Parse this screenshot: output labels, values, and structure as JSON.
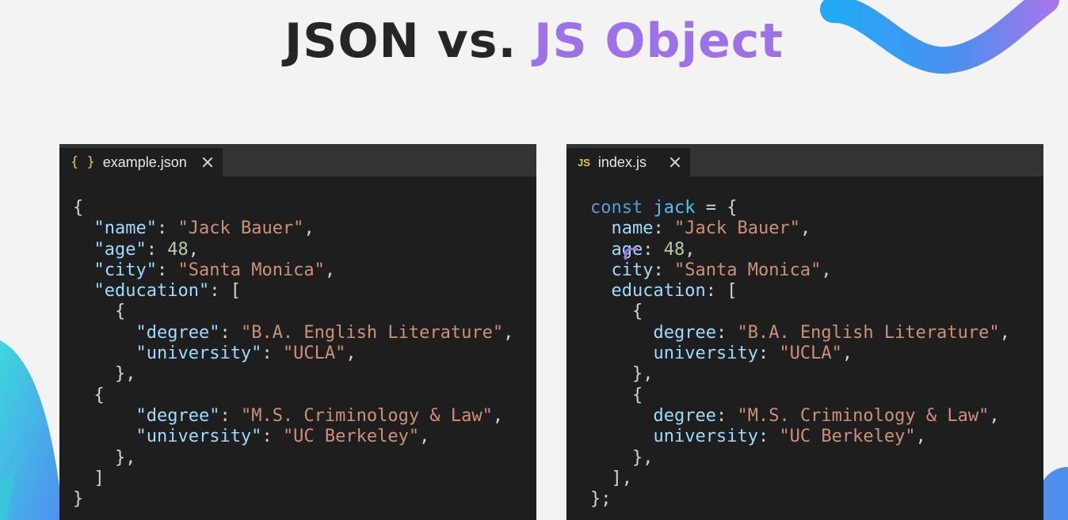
{
  "title": {
    "part1": "JSON vs.",
    "part2": "JS Object"
  },
  "colors": {
    "accent": "#9d71e8",
    "background": "#f3f3f3",
    "editor_bg": "#1e1e1e"
  },
  "editors": [
    {
      "tab_icon": "{ }",
      "tab_icon_name": "json-braces-icon",
      "tab_label": "example.json",
      "lines": [
        [
          {
            "t": "{",
            "c": "p"
          }
        ],
        [
          {
            "t": "  "
          },
          {
            "t": "\"name\"",
            "c": "key"
          },
          {
            "t": ": "
          },
          {
            "t": "\"Jack Bauer\"",
            "c": "str"
          },
          {
            "t": ","
          }
        ],
        [
          {
            "t": "  "
          },
          {
            "t": "\"age\"",
            "c": "key"
          },
          {
            "t": ": "
          },
          {
            "t": "48",
            "c": "num"
          },
          {
            "t": ","
          }
        ],
        [
          {
            "t": "  "
          },
          {
            "t": "\"city\"",
            "c": "key"
          },
          {
            "t": ": "
          },
          {
            "t": "\"Santa Monica\"",
            "c": "str"
          },
          {
            "t": ","
          }
        ],
        [
          {
            "t": "  "
          },
          {
            "t": "\"education\"",
            "c": "key"
          },
          {
            "t": ": ["
          }
        ],
        [
          {
            "t": "    {"
          }
        ],
        [
          {
            "t": "      "
          },
          {
            "t": "\"degree\"",
            "c": "key"
          },
          {
            "t": ": "
          },
          {
            "t": "\"B.A. English Literature\"",
            "c": "str"
          },
          {
            "t": ","
          }
        ],
        [
          {
            "t": "      "
          },
          {
            "t": "\"university\"",
            "c": "key"
          },
          {
            "t": ": "
          },
          {
            "t": "\"UCLA\"",
            "c": "str"
          },
          {
            "t": ","
          }
        ],
        [
          {
            "t": "    },"
          }
        ],
        [
          {
            "t": "  {"
          }
        ],
        [
          {
            "t": "      "
          },
          {
            "t": "\"degree\"",
            "c": "key"
          },
          {
            "t": ": "
          },
          {
            "t": "\"M.S. Criminology & Law\"",
            "c": "str"
          },
          {
            "t": ","
          }
        ],
        [
          {
            "t": "      "
          },
          {
            "t": "\"university\"",
            "c": "key"
          },
          {
            "t": ": "
          },
          {
            "t": "\"UC Berkeley\"",
            "c": "str"
          },
          {
            "t": ","
          }
        ],
        [
          {
            "t": "    },"
          }
        ],
        [
          {
            "t": "  ]"
          }
        ],
        [
          {
            "t": "}"
          }
        ]
      ]
    },
    {
      "tab_icon": "JS",
      "tab_icon_name": "javascript-file-icon",
      "tab_label": "index.js",
      "lines": [
        [
          {
            "t": "const",
            "c": "kw"
          },
          {
            "t": " "
          },
          {
            "t": "jack",
            "c": "var"
          },
          {
            "t": " = {"
          }
        ],
        [
          {
            "t": "  "
          },
          {
            "t": "name",
            "c": "key"
          },
          {
            "t": ": "
          },
          {
            "t": "\"Jack Bauer\"",
            "c": "str"
          },
          {
            "t": ","
          }
        ],
        [
          {
            "t": "  "
          },
          {
            "t": "age",
            "c": "key"
          },
          {
            "t": ": "
          },
          {
            "t": "48",
            "c": "num"
          },
          {
            "t": ","
          }
        ],
        [
          {
            "t": "  "
          },
          {
            "t": "city",
            "c": "key"
          },
          {
            "t": ": "
          },
          {
            "t": "\"Santa Monica\"",
            "c": "str"
          },
          {
            "t": ","
          }
        ],
        [
          {
            "t": "  "
          },
          {
            "t": "education",
            "c": "key"
          },
          {
            "t": ": ["
          }
        ],
        [
          {
            "t": "    {"
          }
        ],
        [
          {
            "t": "      "
          },
          {
            "t": "degree",
            "c": "key"
          },
          {
            "t": ": "
          },
          {
            "t": "\"B.A. English Literature\"",
            "c": "str"
          },
          {
            "t": ","
          }
        ],
        [
          {
            "t": "      "
          },
          {
            "t": "university",
            "c": "key"
          },
          {
            "t": ": "
          },
          {
            "t": "\"UCLA\"",
            "c": "str"
          },
          {
            "t": ","
          }
        ],
        [
          {
            "t": "    },"
          }
        ],
        [
          {
            "t": "    {"
          }
        ],
        [
          {
            "t": "      "
          },
          {
            "t": "degree",
            "c": "key"
          },
          {
            "t": ": "
          },
          {
            "t": "\"M.S. Criminology & Law\"",
            "c": "str"
          },
          {
            "t": ","
          }
        ],
        [
          {
            "t": "      "
          },
          {
            "t": "university",
            "c": "key"
          },
          {
            "t": ": "
          },
          {
            "t": "\"UC Berkeley\"",
            "c": "str"
          },
          {
            "t": ","
          }
        ],
        [
          {
            "t": "    },"
          }
        ],
        [
          {
            "t": "  ],"
          }
        ],
        [
          {
            "t": "};"
          }
        ]
      ]
    }
  ]
}
